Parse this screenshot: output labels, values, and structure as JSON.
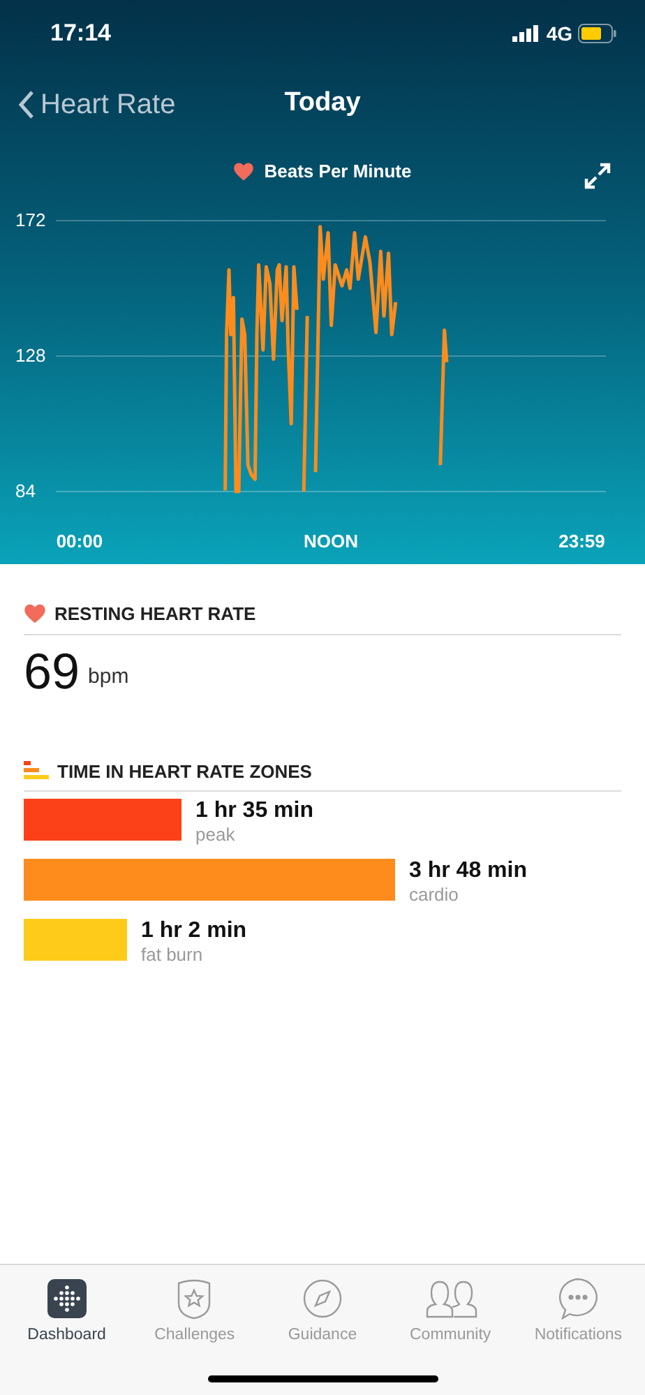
{
  "status_bar": {
    "time": "17:14",
    "network": "4G"
  },
  "nav": {
    "back_label": "Heart Rate",
    "title": "Today"
  },
  "chart": {
    "chart_data": {
      "type": "line",
      "grid": true,
      "xlim": [
        -1.13,
        25.13
      ],
      "ylim": [
        84,
        172
      ],
      "xticks": [
        {
          "value": 0,
          "label": "00:00"
        },
        {
          "value": 12,
          "label": "NOON"
        },
        {
          "value": 23.98,
          "label": "23:59"
        }
      ],
      "yticks": [
        84,
        128,
        172
      ],
      "x": [
        6.957,
        7.023,
        7.132,
        7.22,
        7.351,
        7.471,
        7.603,
        7.755,
        7.887,
        8.04,
        8.204,
        8.379,
        8.467,
        8.553,
        8.761,
        8.915,
        9.089,
        9.264,
        9.439,
        9.537,
        9.669,
        9.865,
        9.953,
        10.106,
        10.237,
        10.379,
        null,
        10.707,
        10.871,
        null,
        11.265,
        11.484,
        11.637,
        11.867,
        12.019,
        12.205,
        12.533,
        12.752,
        12.916,
        13.135,
        13.309,
        13.649,
        13.867,
        14.151,
        14.381,
        14.534,
        14.753,
        14.906,
        15.092,
        null,
        17.224,
        17.421,
        17.53
      ],
      "series": [
        {
          "name": "Beats Per Minute",
          "color": "#fd8c1d",
          "values": [
            84.3,
            135,
            156,
            135,
            147,
            84,
            84,
            140,
            135,
            92.6,
            89.5,
            88,
            135,
            157.6,
            130,
            157,
            151.6,
            127,
            156,
            157.6,
            139.5,
            157,
            132,
            106,
            157,
            143,
            null,
            84,
            141,
            null,
            90.3,
            170,
            153,
            168,
            138,
            157.6,
            150.8,
            156,
            150,
            168,
            153,
            166.7,
            158.4,
            135.7,
            162,
            141,
            161.4,
            135,
            145.5,
            null,
            92.6,
            136.4,
            126
          ]
        }
      ]
    }
  },
  "resting": {
    "heading": "RESTING HEART RATE",
    "value": "69",
    "unit": "bpm"
  },
  "zones": {
    "heading": "TIME IN HEART RATE ZONES",
    "items": [
      {
        "duration": "1 hr 35 min",
        "label": "peak",
        "color": "#fc4119"
      },
      {
        "duration": "3 hr 48 min",
        "label": "cardio",
        "color": "#fd8c1d"
      },
      {
        "duration": "1 hr 2 min",
        "label": "fat burn",
        "color": "#fecb1a"
      }
    ]
  },
  "tabs": [
    {
      "label": "Dashboard",
      "kind": "dashboard",
      "selected": true
    },
    {
      "label": "Challenges",
      "kind": "challenges",
      "selected": false
    },
    {
      "label": "Guidance",
      "kind": "guidance",
      "selected": false
    },
    {
      "label": "Community",
      "kind": "community",
      "selected": false
    },
    {
      "label": "Notifications",
      "kind": "notifications",
      "selected": false
    }
  ]
}
